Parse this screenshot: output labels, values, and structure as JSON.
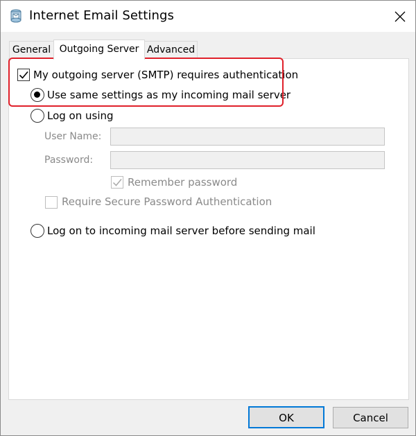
{
  "window": {
    "title": "Internet Email Settings",
    "icon": "email-settings-icon"
  },
  "tabs": [
    {
      "label": "General",
      "active": false
    },
    {
      "label": "Outgoing Server",
      "active": true
    },
    {
      "label": "Advanced",
      "active": false
    }
  ],
  "outgoing": {
    "requires_auth_label": "My outgoing server (SMTP) requires authentication",
    "requires_auth_checked": true,
    "use_same_label": "Use same settings as my incoming mail server",
    "use_same_selected": true,
    "log_on_using_label": "Log on using",
    "log_on_using_selected": false,
    "username_label": "User Name:",
    "username_value": "",
    "password_label": "Password:",
    "password_value": "",
    "remember_label": "Remember password",
    "remember_checked": true,
    "spa_label": "Require Secure Password Authentication",
    "spa_checked": false,
    "log_on_incoming_label": "Log on to incoming mail server before sending mail",
    "log_on_incoming_selected": false
  },
  "buttons": {
    "ok_label": "OK",
    "cancel_label": "Cancel"
  },
  "colors": {
    "highlight": "#e0202a",
    "focus_border": "#0078d7"
  }
}
